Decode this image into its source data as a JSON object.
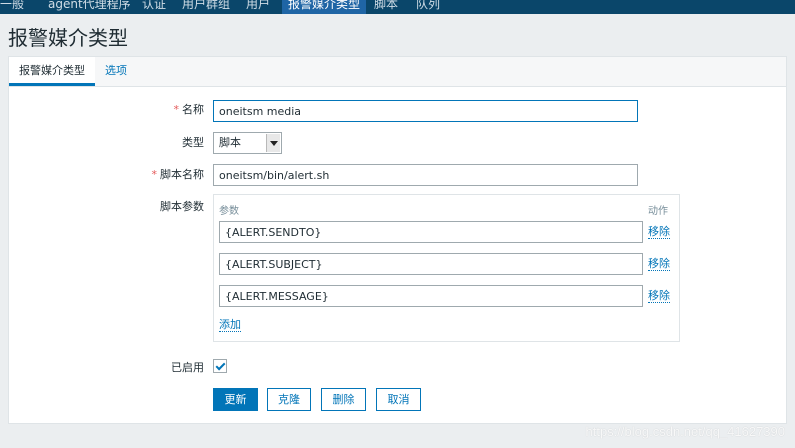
{
  "top_nav": {
    "items": [
      "一般",
      "agent代理程序",
      "认证",
      "用户群组",
      "用户",
      "报警媒介类型",
      "脚本",
      "队列"
    ],
    "active_index": 5
  },
  "page": {
    "title": "报警媒介类型"
  },
  "tabs": [
    "报警媒介类型",
    "选项"
  ],
  "form": {
    "name_label": "名称",
    "name_value": "oneitsm media",
    "type_label": "类型",
    "type_value": "脚本",
    "script_name_label": "脚本名称",
    "script_name_value": "oneitsm/bin/alert.sh",
    "script_params_label": "脚本参数",
    "params_header": "参数",
    "action_header": "动作",
    "params": [
      {
        "value": "{ALERT.SENDTO}",
        "remove": "移除"
      },
      {
        "value": "{ALERT.SUBJECT}",
        "remove": "移除"
      },
      {
        "value": "{ALERT.MESSAGE}",
        "remove": "移除"
      }
    ],
    "add_label": "添加",
    "enabled_label": "已启用",
    "enabled": true
  },
  "buttons": {
    "update": "更新",
    "clone": "克隆",
    "delete": "删除",
    "cancel": "取消"
  },
  "watermark": "https://blog.csdn.net/qq_41627390",
  "colors": {
    "nav_bg": "#0a466a",
    "accent": "#0275b8",
    "required": "#e45959"
  }
}
